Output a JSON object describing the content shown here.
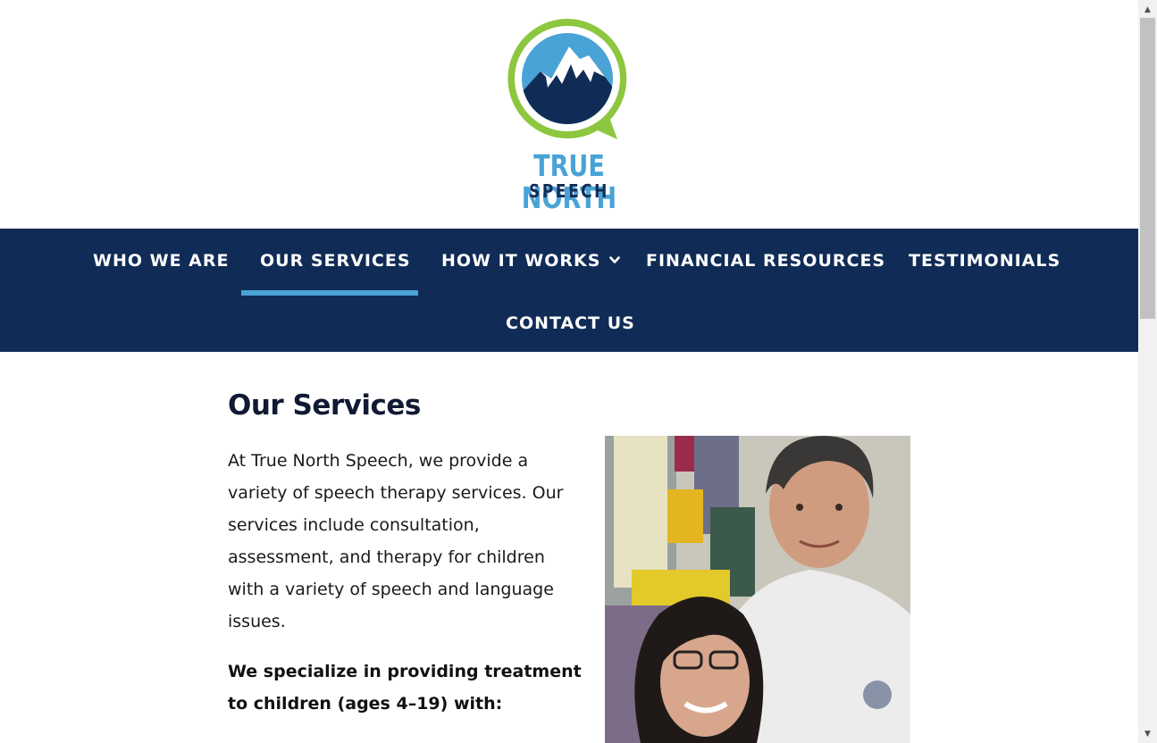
{
  "brand": {
    "name_line1": "TRUE NORTH",
    "name_line2": "SPEECH",
    "logo_icon": "mountain-speech-bubble-logo",
    "colors": {
      "green": "#8dc63f",
      "sky": "#4aa3d6",
      "navy": "#102c56"
    }
  },
  "nav": {
    "items": [
      {
        "label": "WHO WE ARE"
      },
      {
        "label": "OUR SERVICES",
        "active": true
      },
      {
        "label": "HOW IT WORKS",
        "has_dropdown": true,
        "icon": "chevron-down-icon"
      },
      {
        "label": "FINANCIAL RESOURCES"
      },
      {
        "label": "TESTIMONIALS"
      },
      {
        "label": "CONTACT US"
      }
    ],
    "background": "#102c56",
    "active_underline": "#4aa3d6"
  },
  "main": {
    "title": "Our Services",
    "intro": "At True North Speech, we provide a variety of speech therapy services. Our services include consultation, assessment, and therapy for children with a variety of speech and language issues.",
    "specialize_heading": "We specialize in providing treatment to children (ages 4–19) with:",
    "photo": "photo of a smiling woman and teenage boy"
  }
}
